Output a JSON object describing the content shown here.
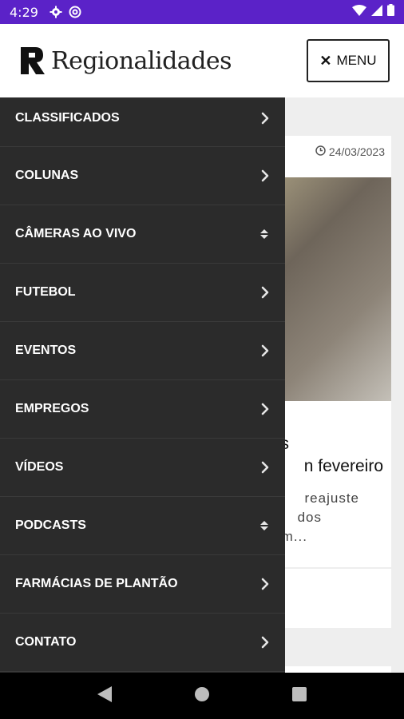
{
  "status_bar": {
    "time": "4:29",
    "icons": [
      "gear-icon",
      "at-icon",
      "wifi-icon",
      "signal-icon",
      "battery-icon"
    ]
  },
  "header": {
    "brand": "Regionalidades",
    "menu_button": "MENU"
  },
  "background": {
    "card_date": "24/03/2023",
    "headline_line1": "s",
    "headline_line2": "n fevereiro",
    "excerpt_line1": "reajuste",
    "excerpt_line2": "dos",
    "excerpt_line3": "m..."
  },
  "drawer": {
    "items": [
      {
        "label": "CLASSIFICADOS",
        "arrow": "chevron-right-icon"
      },
      {
        "label": "COLUNAS",
        "arrow": "chevron-right-icon"
      },
      {
        "label": "CÂMERAS AO VIVO",
        "arrow": "sort-icon"
      },
      {
        "label": "FUTEBOL",
        "arrow": "chevron-right-icon"
      },
      {
        "label": "EVENTOS",
        "arrow": "chevron-right-icon"
      },
      {
        "label": "EMPREGOS",
        "arrow": "chevron-right-icon"
      },
      {
        "label": "VÍDEOS",
        "arrow": "chevron-right-icon"
      },
      {
        "label": "PODCASTS",
        "arrow": "sort-icon"
      },
      {
        "label": "FARMÁCIAS DE PLANTÃO",
        "arrow": "chevron-right-icon"
      },
      {
        "label": "CONTATO",
        "arrow": "chevron-right-icon"
      }
    ]
  },
  "colors": {
    "status_bar": "#5b22c8",
    "drawer_bg": "#2b2b2b",
    "header_bg": "#ffffff",
    "nav_bar": "#000000"
  }
}
